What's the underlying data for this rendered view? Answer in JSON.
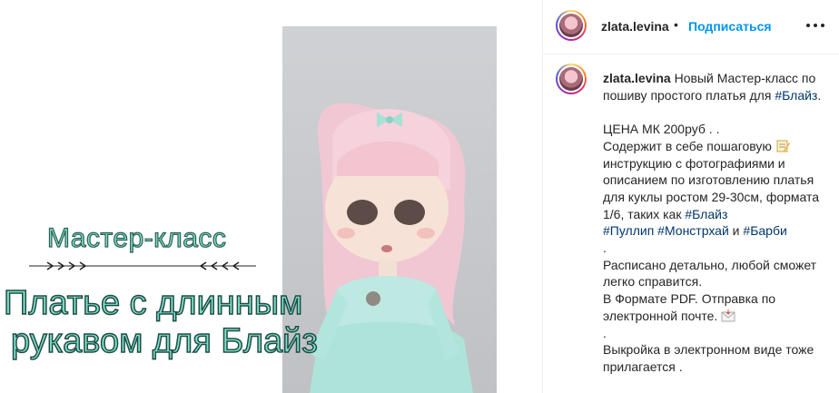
{
  "post": {
    "overlay": {
      "title": "Мастер-класс",
      "line1": "Платье с длинным",
      "line2": "рукавом для Блайз"
    }
  },
  "header": {
    "username": "zlata.levina",
    "separator": "•",
    "follow_label": "Подписаться",
    "more_icon": "more-horizontal-icon"
  },
  "caption": {
    "username": "zlata.levina",
    "intro": " Новый Мастер-класс по пошиву простого платья для ",
    "tag_blythe": "#Блайз",
    "after_tag": ".\n\nЦЕНА МК 200руб . .\nСодержит в себе пошаговую ",
    "emoji_memo": "memo-emoji",
    "instructions": " инструкцию с фотографиями и описанием по изготовлению платья для куклы ростом 29-30см, формата 1/6, таких как ",
    "tag_blythe2": "#Блайз",
    "tag_pullip": "#Пуллип",
    "tag_monster": "#Монстрхай",
    "and_text": " и ",
    "tag_barbie": "#Барби",
    "body_end": "\n.\nРасписано детально, любой сможет легко справится.\nВ Формате PDF. Отправка по электронной почте. ",
    "emoji_mail": "envelope-emoji",
    "footer": "\n.\nВыкройка в электронном виде тоже прилагается ."
  },
  "colors": {
    "overlay_fill": "#7fe0cc",
    "overlay_stroke": "#2c5f56",
    "follow": "#0095f6",
    "hashtag": "#00376b"
  }
}
